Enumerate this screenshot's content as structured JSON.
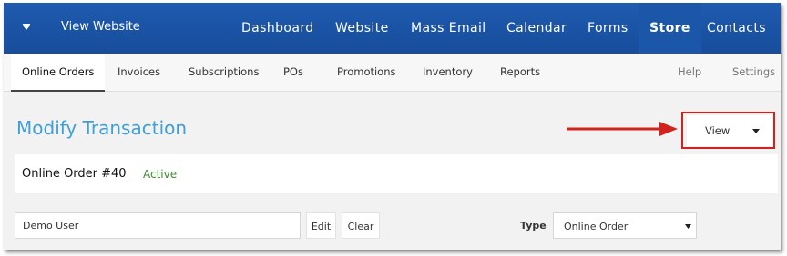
{
  "header": {
    "view_website": "View Website",
    "nav": [
      "Dashboard",
      "Website",
      "Mass Email",
      "Calendar",
      "Forms",
      "Store",
      "Contacts"
    ],
    "active_nav": "Store",
    "bg_color": "#1f5bb0"
  },
  "subnav": {
    "tabs": [
      "Online Orders",
      "Invoices",
      "Subscriptions",
      "POs",
      "Promotions",
      "Inventory",
      "Reports"
    ],
    "right_tabs": [
      "Help",
      "Settings"
    ],
    "active_tab": "Online Orders"
  },
  "page": {
    "title": "Modify Transaction",
    "view_dropdown": "View",
    "title_color": "#3f9fd9",
    "highlight_color": "#d0231e"
  },
  "order": {
    "title": "Online Order #40",
    "status": "Active",
    "status_color": "#3a8d2d"
  },
  "form": {
    "customer_value": "Demo User",
    "edit_label": "Edit",
    "clear_label": "Clear",
    "type_label": "Type",
    "type_value": "Online Order"
  }
}
